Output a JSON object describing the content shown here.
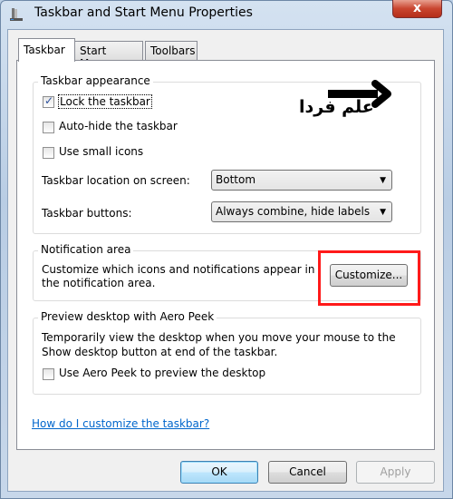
{
  "window": {
    "title": "Taskbar and Start Menu Properties",
    "close_label": "x"
  },
  "tabs": [
    {
      "label": "Taskbar",
      "active": true
    },
    {
      "label": "Start Menu",
      "active": false
    },
    {
      "label": "Toolbars",
      "active": false
    }
  ],
  "appearance": {
    "title": "Taskbar appearance",
    "lock": {
      "label": "Lock the taskbar",
      "checked": true
    },
    "autohide": {
      "label": "Auto-hide the taskbar",
      "checked": false
    },
    "small_icons": {
      "label": "Use small icons",
      "checked": false
    },
    "location": {
      "label": "Taskbar location on screen:",
      "value": "Bottom"
    },
    "buttons": {
      "label": "Taskbar buttons:",
      "value": "Always combine, hide labels"
    }
  },
  "notification": {
    "title": "Notification area",
    "text": "Customize which icons and notifications appear in the notification area.",
    "customize_label": "Customize..."
  },
  "peek": {
    "title": "Preview desktop with Aero Peek",
    "text": "Temporarily view the desktop when you move your mouse to the Show desktop button at end of the taskbar.",
    "checkbox": {
      "label": "Use Aero Peek to preview the desktop",
      "checked": false
    }
  },
  "help_link": "How do I customize the taskbar?",
  "footer": {
    "ok": "OK",
    "cancel": "Cancel",
    "apply": "Apply"
  },
  "watermark": {
    "text": "علم فردا"
  },
  "colors": {
    "highlight": "#ff1a1a",
    "link": "#0066cc"
  }
}
